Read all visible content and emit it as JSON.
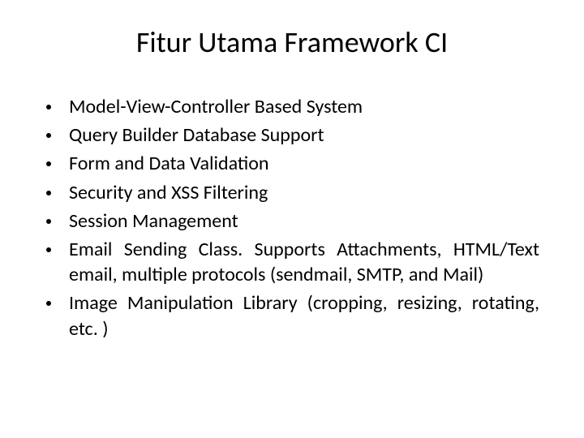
{
  "title": "Fitur Utama Framework CI",
  "items": [
    {
      "text": "Model-View-Controller Based System",
      "justify": false
    },
    {
      "text": "Query Builder Database Support",
      "justify": false
    },
    {
      "text": "Form and Data Validation",
      "justify": false
    },
    {
      "text": "Security and XSS Filtering",
      "justify": false
    },
    {
      "text": "Session Management",
      "justify": false
    },
    {
      "text": "Email Sending Class. Supports Attachments, HTML/Text email, multiple protocols (sendmail, SMTP, and Mail)",
      "justify": true
    },
    {
      "text": "Image Manipulation Library (cropping, resizing, rotating, etc. )",
      "justify": true
    }
  ]
}
